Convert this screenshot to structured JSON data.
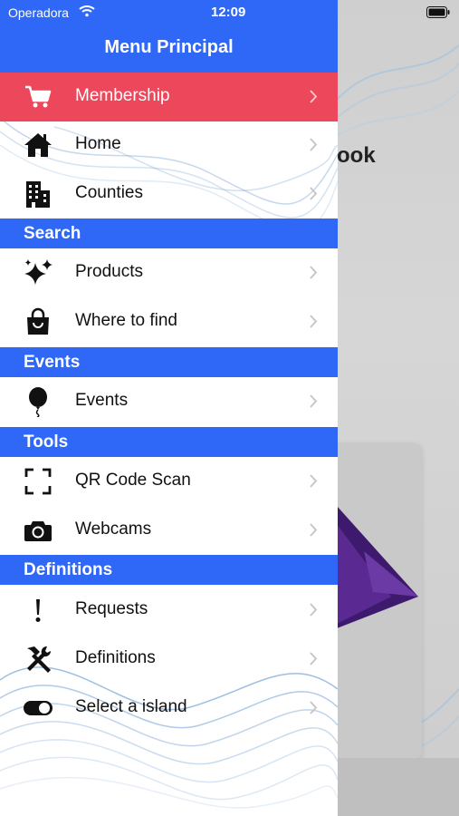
{
  "status_bar": {
    "carrier": "Operadora",
    "time": "12:09"
  },
  "background_app": {
    "title_fragment": "ook"
  },
  "drawer": {
    "title": "Menu Principal",
    "highlight_color": "#ec475a",
    "accent_color": "#2f67f6",
    "items_top": [
      {
        "label": "Membership",
        "icon": "cart-icon"
      },
      {
        "label": "Home",
        "icon": "home-icon"
      },
      {
        "label": "Counties",
        "icon": "buildings-icon"
      }
    ],
    "sections": [
      {
        "title": "Search",
        "items": [
          {
            "label": "Products",
            "icon": "sparkles-icon"
          },
          {
            "label": "Where to find",
            "icon": "shopping-bag-icon"
          }
        ]
      },
      {
        "title": "Events",
        "items": [
          {
            "label": "Events",
            "icon": "balloon-icon"
          }
        ]
      },
      {
        "title": "Tools",
        "items": [
          {
            "label": "QR Code Scan",
            "icon": "qr-scan-icon"
          },
          {
            "label": "Webcams",
            "icon": "camera-icon"
          }
        ]
      },
      {
        "title": "Definitions",
        "items": [
          {
            "label": "Requests",
            "icon": "exclamation-icon"
          },
          {
            "label": "Definitions",
            "icon": "tools-icon"
          },
          {
            "label": "Select a island",
            "icon": "toggle-icon"
          }
        ]
      }
    ]
  }
}
